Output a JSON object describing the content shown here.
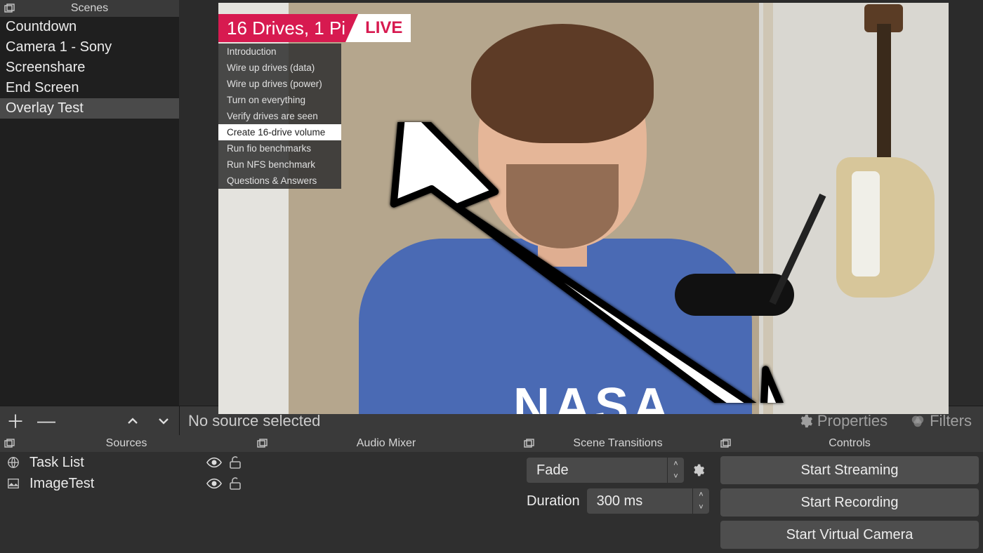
{
  "scenes": {
    "title": "Scenes",
    "items": [
      "Countdown",
      "Camera 1 - Sony",
      "Screenshare",
      "End Screen",
      "Overlay Test"
    ],
    "selected": 4
  },
  "preview": {
    "overlay_title": "16 Drives, 1 Pi",
    "overlay_live": "LIVE",
    "shirt_text": "NASA",
    "tasks": [
      "Introduction",
      "Wire up drives (data)",
      "Wire up drives (power)",
      "Turn on everything",
      "Verify drives are seen",
      "Create 16-drive volume",
      "Run fio benchmarks",
      "Run NFS benchmark",
      "Questions & Answers"
    ],
    "task_highlight": 5
  },
  "source_toolbar": {
    "status": "No source selected",
    "properties": "Properties",
    "filters": "Filters"
  },
  "sources": {
    "title": "Sources",
    "items": [
      {
        "name": "Task List",
        "icon": "globe"
      },
      {
        "name": "ImageTest",
        "icon": "image"
      }
    ]
  },
  "mixer": {
    "title": "Audio Mixer"
  },
  "transitions": {
    "title": "Scene Transitions",
    "current": "Fade",
    "duration_label": "Duration",
    "duration_value": "300 ms"
  },
  "controls": {
    "title": "Controls",
    "buttons": [
      "Start Streaming",
      "Start Recording",
      "Start Virtual Camera"
    ]
  }
}
